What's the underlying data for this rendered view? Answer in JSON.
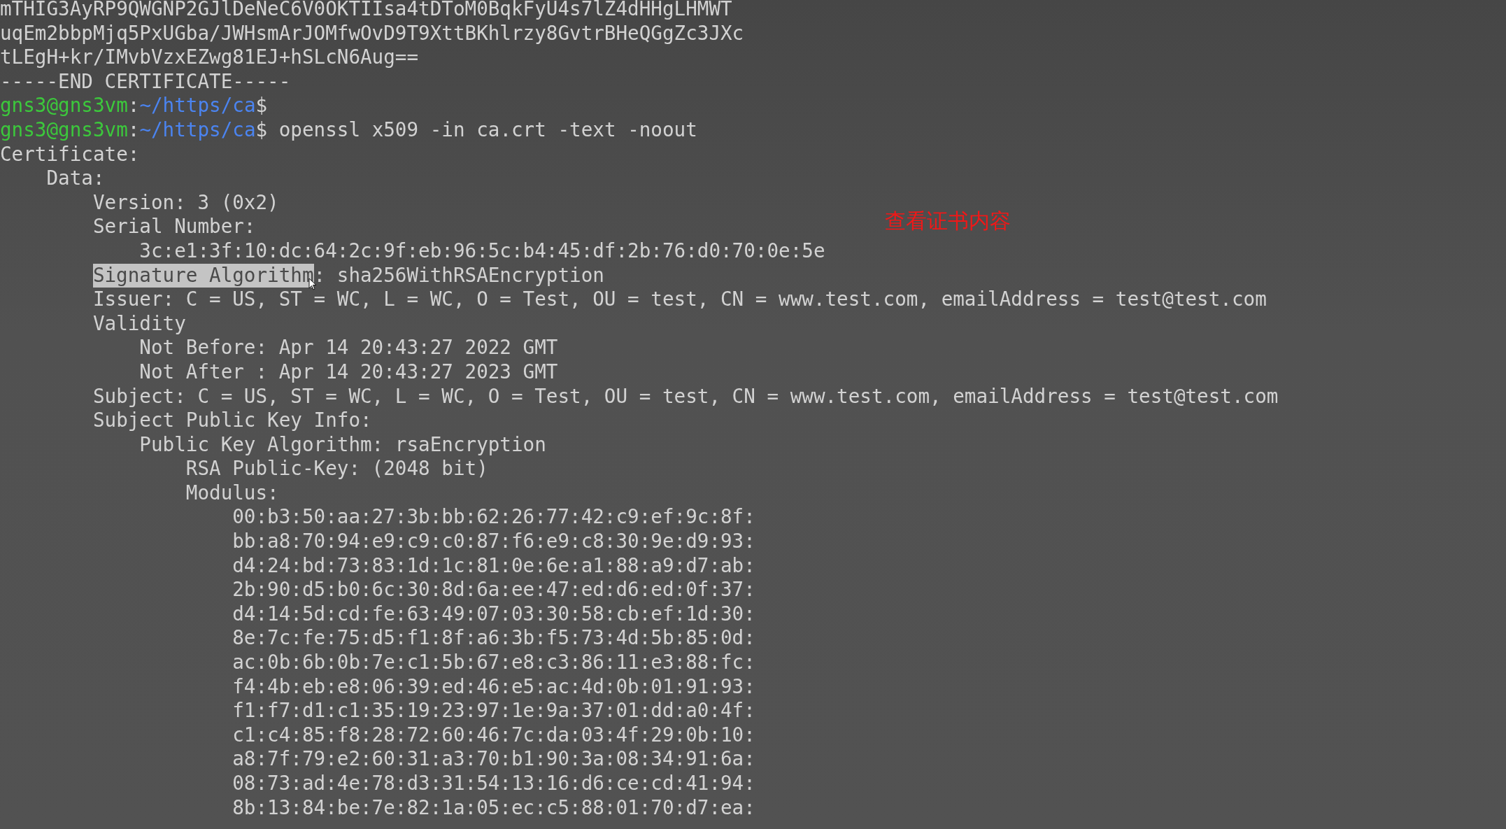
{
  "terminal": {
    "lines": [
      [
        {
          "kind": "output",
          "text": "mTH"
        },
        {
          "kind": "output",
          "text": "IG3AyRP9QWGNP2GJlDeNeC6V0OKTIIsa4tDToM0BqkFyU4s7lZ4dHHgLHMWT"
        }
      ],
      [
        {
          "kind": "output",
          "text": "uqEm2bbpMjq5PxUGba/JWHsmArJOMfwOvD9T9XttBKhlrzy8GvtrBHeQGgZc3JXc"
        }
      ],
      [
        {
          "kind": "output",
          "text": "tLEgH+kr/IMvbVzxEZwg81EJ+hSLcN6Aug=="
        }
      ],
      [
        {
          "kind": "output",
          "text": "-----END CERTIFICATE-----"
        }
      ],
      [
        {
          "kind": "user",
          "text": "gns3@gns3vm"
        },
        {
          "kind": "output",
          "text": ":"
        },
        {
          "kind": "path",
          "text": "~/https/ca"
        },
        {
          "kind": "output",
          "text": "$"
        }
      ],
      [
        {
          "kind": "user",
          "text": "gns3@gns3vm"
        },
        {
          "kind": "output",
          "text": ":"
        },
        {
          "kind": "path",
          "text": "~/https/ca"
        },
        {
          "kind": "output",
          "text": "$ openssl x509 -in ca.crt -text -noout"
        }
      ],
      [
        {
          "kind": "output",
          "text": "Certificate:"
        }
      ],
      [
        {
          "kind": "output",
          "text": "    Data:"
        }
      ],
      [
        {
          "kind": "output",
          "text": "        Version: 3 (0x2)"
        }
      ],
      [
        {
          "kind": "output",
          "text": "        Serial Number:"
        }
      ],
      [
        {
          "kind": "output",
          "text": "            3c:e1:3f:10:dc:64:2c:9f:eb:96:5c:b4:45:df:2b:76:d0:70:0e:5e"
        }
      ],
      [
        {
          "kind": "selection",
          "text": "Signature Algorithm"
        },
        {
          "kind": "output",
          "text": ": sha256WithRSAEncryption"
        }
      ],
      [
        {
          "kind": "output",
          "text": "        Issuer: C = US, ST = WC, L = WC, O = Test, OU = test, CN = www.test.com, emailAddress = test@test.com"
        }
      ],
      [
        {
          "kind": "output",
          "text": "        Validity"
        }
      ],
      [
        {
          "kind": "output",
          "text": "            Not Before: Apr 14 20:43:27 2022 GMT"
        }
      ],
      [
        {
          "kind": "output",
          "text": "            Not After : Apr 14 20:43:27 2023 GMT"
        }
      ],
      [
        {
          "kind": "output",
          "text": "        Subject: C = US, ST = WC, L = WC, O = Test, OU = test, CN = www.test.com, emailAddress = test@test.com"
        }
      ],
      [
        {
          "kind": "output",
          "text": "        Subject Public Key Info:"
        }
      ],
      [
        {
          "kind": "output",
          "text": "            Public Key Algorithm: rsaEncryption"
        }
      ],
      [
        {
          "kind": "output",
          "text": "                RSA Public-Key: (2048 bit)"
        }
      ],
      [
        {
          "kind": "output",
          "text": "                Modulus:"
        }
      ],
      [
        {
          "kind": "output",
          "text": "                    00:b3:50:aa:27:3b:bb:62:26:77:42:c9:ef:9c:8f:"
        }
      ],
      [
        {
          "kind": "output",
          "text": "                    bb:a8:70:94:e9:c9:c0:87:f6:e9:c8:30:9e:d9:93:"
        }
      ],
      [
        {
          "kind": "output",
          "text": "                    d4:24:bd:73:83:1d:1c:81:0e:6e:a1:88:a9:d7:ab:"
        }
      ],
      [
        {
          "kind": "output",
          "text": "                    2b:90:d5:b0:6c:30:8d:6a:ee:47:ed:d6:ed:0f:37:"
        }
      ],
      [
        {
          "kind": "output",
          "text": "                    d4:14:5d:cd:fe:63:49:07:03:30:58:cb:ef:1d:30:"
        }
      ],
      [
        {
          "kind": "output",
          "text": "                    8e:7c:fe:75:d5:f1:8f:a6:3b:f5:73:4d:5b:85:0d:"
        }
      ],
      [
        {
          "kind": "output",
          "text": "                    ac:0b:6b:0b:7e:c1:5b:67:e8:c3:86:11:e3:88:fc:"
        }
      ],
      [
        {
          "kind": "output",
          "text": "                    f4:4b:eb:e8:06:39:ed:46:e5:ac:4d:0b:01:91:93:"
        }
      ],
      [
        {
          "kind": "output",
          "text": "                    f1:f7:d1:c1:35:19:23:97:1e:9a:37:01:dd:a0:4f:"
        }
      ],
      [
        {
          "kind": "output",
          "text": "                    c1:c4:85:f8:28:72:60:46:7c:da:03:4f:29:0b:10:"
        }
      ],
      [
        {
          "kind": "output",
          "text": "                    a8:7f:79:e2:60:31:a3:70:b1:90:3a:08:34:91:6a:"
        }
      ],
      [
        {
          "kind": "output",
          "text": "                    08:73:ad:4e:78:d3:31:54:13:16:d6:ce:cd:41:94:"
        }
      ],
      [
        {
          "kind": "output",
          "text": "                    8b:13:84:be:7e:82:1a:05:ec:c5:88:01:70:d7:ea:"
        }
      ]
    ]
  },
  "annotation": {
    "text": "查看证书内容"
  }
}
